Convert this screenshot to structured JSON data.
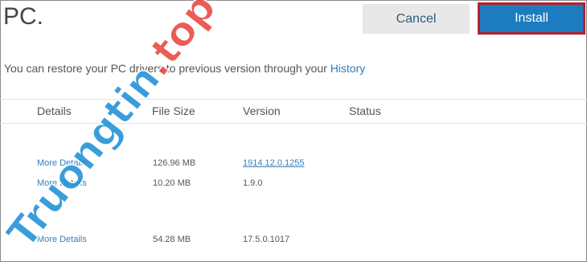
{
  "header": {
    "title": "PC."
  },
  "actions": {
    "cancel_label": "Cancel",
    "install_label": "Install"
  },
  "info": {
    "text": "You can restore your PC drivers to previous version through your ",
    "link_label": "History"
  },
  "table": {
    "columns": [
      "Details",
      "File Size",
      "Version",
      "Status"
    ],
    "rows": [
      {
        "details": "More Details",
        "size": "126.96 MB",
        "version": "1914.12.0.1255",
        "status": ""
      },
      {
        "details": "More Details",
        "size": "10.20 MB",
        "version": "1.9.0",
        "status": ""
      },
      {
        "details": "More Details",
        "size": "54.28 MB",
        "version": "17.5.0.1017",
        "status": ""
      }
    ]
  },
  "watermark": {
    "text": "Truongtin.top"
  },
  "colors": {
    "accent": "#1d7cbf",
    "highlight_border": "#b4212d",
    "link": "#2b7bb9",
    "watermark_blue": "#1f8fd6",
    "watermark_red": "#e8463f"
  }
}
